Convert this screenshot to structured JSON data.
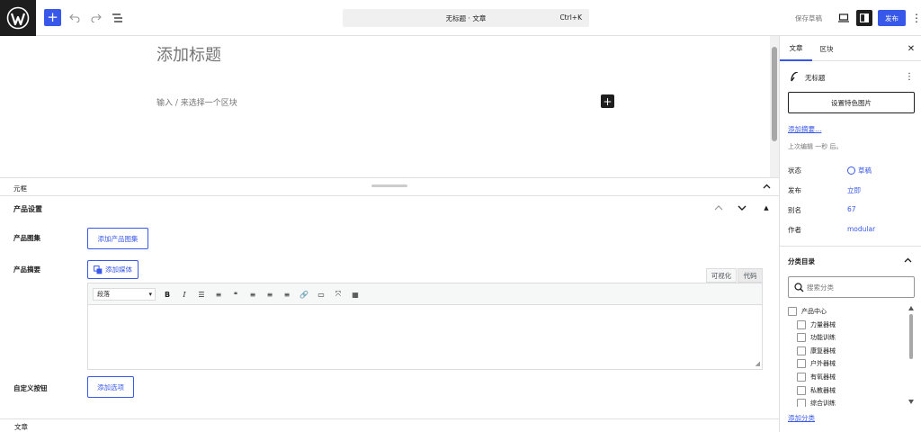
{
  "toolbar": {
    "add_block_symbol": "+",
    "command_bar_title": "无标题 · 文章",
    "command_bar_shortcut": "Ctrl+K",
    "save_draft_label": "保存草稿",
    "publish_label": "发布",
    "more_symbol": "⋮"
  },
  "editor": {
    "title_placeholder": "添加标题",
    "block_hint": "输入 / 来选择一个区块",
    "inline_add_symbol": "+"
  },
  "meta": {
    "header_title": "元框",
    "product_box": {
      "title": "产品设置",
      "toggle_symbol": "▲",
      "gallery_label": "产品图集",
      "gallery_button": "添加产品图集",
      "excerpt_label": "产品摘要",
      "add_media_button": "添加媒体",
      "tab_visual": "可视化",
      "tab_code": "代码",
      "format_select_value": "段落",
      "format_arrow": "▾",
      "tools": [
        {
          "name": "bold-tool",
          "glyph": "B"
        },
        {
          "name": "italic-tool",
          "glyph": "I"
        },
        {
          "name": "bullet-list-tool",
          "glyph": "☰"
        },
        {
          "name": "numbered-list-tool",
          "glyph": "≡"
        },
        {
          "name": "quote-tool",
          "glyph": "❝"
        },
        {
          "name": "align-left-tool",
          "glyph": "≡"
        },
        {
          "name": "align-center-tool",
          "glyph": "≡"
        },
        {
          "name": "align-right-tool",
          "glyph": "≡"
        },
        {
          "name": "link-tool",
          "glyph": "🔗"
        },
        {
          "name": "read-more-tool",
          "glyph": "▭"
        },
        {
          "name": "fullscreen-tool",
          "glyph": "⤧"
        },
        {
          "name": "toolbar-toggle-tool",
          "glyph": "▦"
        }
      ],
      "custom_button_label": "自定义按钮",
      "custom_button": "添加选项"
    }
  },
  "footer": {
    "breadcrumb": "文章"
  },
  "sidebar": {
    "tab_post": "文章",
    "tab_block": "区块",
    "close_symbol": "✕",
    "post_title": "无标题",
    "post_more_symbol": "⋮",
    "featured_image_button": "设置特色图片",
    "add_excerpt_link": "添加摘要…",
    "last_edited": "上次编辑 一秒 后。",
    "rows": {
      "status_label": "状态",
      "status_value": "草稿",
      "publish_label": "发布",
      "publish_value": "立即",
      "slug_label": "别名",
      "slug_value": "67",
      "author_label": "作者",
      "author_value": "modular"
    },
    "categories": {
      "title": "分类目录",
      "search_placeholder": "搜索分类",
      "items": [
        "产品中心",
        "力量器械",
        "功能训练",
        "康复器械",
        "户外器械",
        "有氧器械",
        "私教器械",
        "综合训练"
      ],
      "add_link": "添加分类"
    }
  },
  "colors": {
    "accent": "#3858e9",
    "dark": "#1e1e1e",
    "border": "#e0e0e0"
  }
}
